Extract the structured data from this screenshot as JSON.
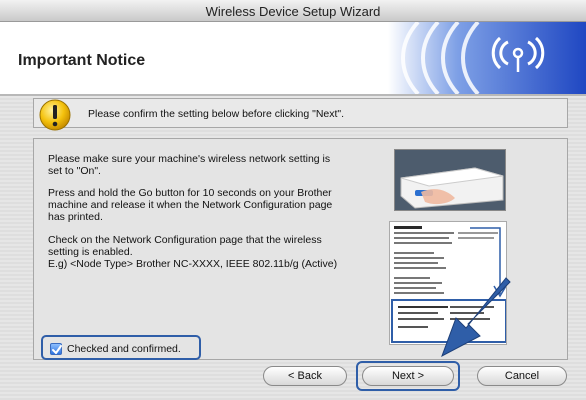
{
  "window": {
    "title": "Wireless Device Setup Wizard"
  },
  "header": {
    "heading": "Important Notice"
  },
  "notice": {
    "text": "Please confirm the setting below before clicking \"Next\"."
  },
  "instructions": {
    "p1_line1": "Please make sure your machine's wireless network setting is",
    "p1_line2": "set to \"On\".",
    "p2_line1": "Press and hold the Go button for 10 seconds on your Brother",
    "p2_line2": "machine and release it when the Network Configuration page",
    "p2_line3": "has printed.",
    "p3_line1": "Check on the Network Configuration page that the wireless",
    "p3_line2": "setting is enabled.",
    "p3_line3": "E.g)  <Node Type> Brother NC-XXXX, IEEE 802.11b/g (Active)"
  },
  "confirm": {
    "label": "Checked and confirmed.",
    "checked": true
  },
  "buttons": {
    "back": "< Back",
    "next": "Next >",
    "cancel": "Cancel"
  },
  "colors": {
    "highlight": "#2f5ea8",
    "brand_blue": "#2a55c8",
    "warning_yellow": "#f4c20d"
  },
  "icons": {
    "header_logo": "wifi-brand-icon",
    "notice": "warning-icon",
    "check": "checkmark-icon"
  }
}
